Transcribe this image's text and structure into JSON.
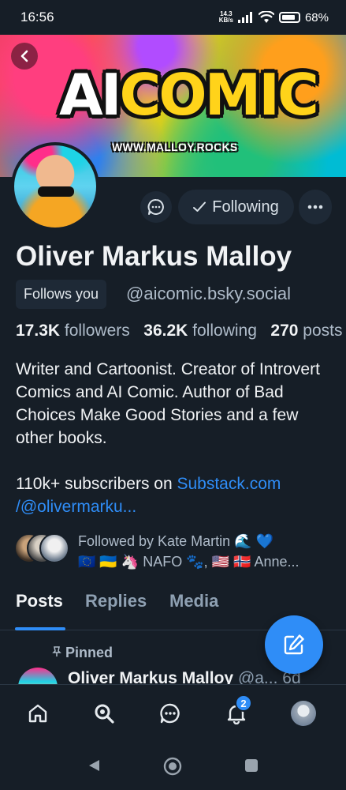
{
  "status_bar": {
    "time": "16:56",
    "net_speed_value": "14.3",
    "net_speed_unit": "KB/s",
    "battery": "68%"
  },
  "banner": {
    "logo_ai": "AI",
    "logo_rest": "COMIC",
    "url": "WWW.MALLOY.ROCKS"
  },
  "profile": {
    "display_name": "Oliver Markus Malloy",
    "follows_you": "Follows you",
    "handle": "@aicomic.bsky.social",
    "following_button": "Following",
    "stats": {
      "followers_count": "17.3K",
      "followers_label": "followers",
      "following_count": "36.2K",
      "following_label": "following",
      "posts_count": "270",
      "posts_label": "posts"
    },
    "bio": "Writer and Cartoonist. Creator of Introvert Comics and AI Comic. Author of Bad Choices Make Good Stories and a few other books.",
    "bio_subscribers_text": "110k+ subscribers on ",
    "bio_link_1": "Substack.com",
    "bio_link_2": "/@olivermarku...",
    "followed_by_line1": "Followed by Kate Martin 🌊 💙",
    "followed_by_line2": "🇪🇺 🇺🇦 🦄 NAFO 🐾, 🇺🇸 🇳🇴 Anne..."
  },
  "tabs": [
    "Posts",
    "Replies",
    "Media"
  ],
  "active_tab": "Posts",
  "pinned_post": {
    "pinned_label": "Pinned",
    "author": "Oliver Markus Malloy",
    "handle": "@a...",
    "time": "6d"
  },
  "bottom_nav": {
    "notifications_badge": "2"
  },
  "colors": {
    "background": "#161e27",
    "accent": "#2f8df7",
    "surface": "#1e2936",
    "muted_text": "#aebbc9"
  }
}
